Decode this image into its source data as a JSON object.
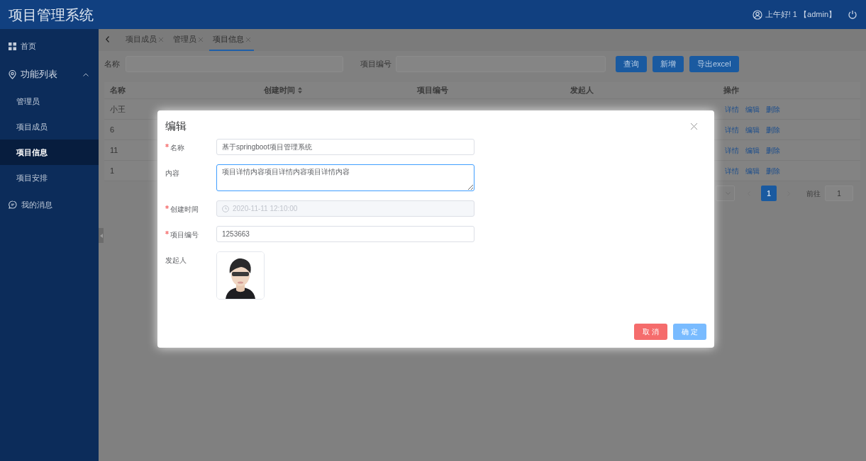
{
  "header": {
    "title": "项目管理系统",
    "greeting": "上午好! 1 【admin】"
  },
  "sidebar": {
    "items": [
      {
        "label": "首页",
        "kind": "page",
        "selected": false
      },
      {
        "label": "功能列表",
        "kind": "group",
        "expanded": true,
        "children": [
          {
            "label": "管理员",
            "selected": false
          },
          {
            "label": "项目成员",
            "selected": false
          },
          {
            "label": "项目信息",
            "selected": true
          },
          {
            "label": "项目安排",
            "selected": false
          }
        ]
      },
      {
        "label": "我的消息",
        "kind": "page",
        "selected": false
      }
    ]
  },
  "tabs": [
    {
      "label": "项目成员",
      "selected": false
    },
    {
      "label": "管理员",
      "selected": false
    },
    {
      "label": "项目信息",
      "selected": true
    }
  ],
  "search": {
    "fields": [
      {
        "label": "名称"
      },
      {
        "label": "项目编号"
      }
    ],
    "buttons": [
      "查询",
      "新增",
      "导出excel"
    ]
  },
  "table": {
    "columns": [
      {
        "label": "名称",
        "sortable": false
      },
      {
        "label": "创建时间",
        "sortable": true
      },
      {
        "label": "项目编号",
        "sortable": false
      },
      {
        "label": "发起人",
        "sortable": false
      },
      {
        "label": "操作",
        "sortable": false
      }
    ],
    "rows": [
      {
        "name": "小王",
        "actions": [
          "详情",
          "编辑",
          "删除"
        ]
      },
      {
        "name": "6",
        "actions": [
          "详情",
          "编辑",
          "删除"
        ]
      },
      {
        "name": "11",
        "actions": [
          "详情",
          "编辑",
          "删除"
        ]
      },
      {
        "name": "1",
        "actions": [
          "详情",
          "编辑",
          "删除"
        ]
      }
    ]
  },
  "pagination": {
    "pages": [
      {
        "label": "1",
        "selected": true
      }
    ],
    "goto_label": "前往",
    "goto_value": "1"
  },
  "dialog": {
    "title": "编辑",
    "fields": [
      {
        "label": "名称",
        "required": true,
        "kind": "input",
        "value": "基于springboot项目管理系统",
        "disabled": false,
        "focused": false
      },
      {
        "label": "内容",
        "required": false,
        "kind": "textarea",
        "value": "项目详情内容项目详情内容项目详情内容",
        "disabled": false,
        "focused": true
      },
      {
        "label": "创建时间",
        "required": true,
        "kind": "datetime",
        "value": "2020-11-11 12:10:00",
        "disabled": true,
        "focused": false
      },
      {
        "label": "项目编号",
        "required": true,
        "kind": "input",
        "value": "1253663",
        "disabled": false,
        "focused": false
      },
      {
        "label": "发起人",
        "required": false
      }
    ],
    "buttons": [
      {
        "label": "取 消",
        "kind": "danger"
      },
      {
        "label": "确 定",
        "kind": "primary"
      }
    ]
  }
}
